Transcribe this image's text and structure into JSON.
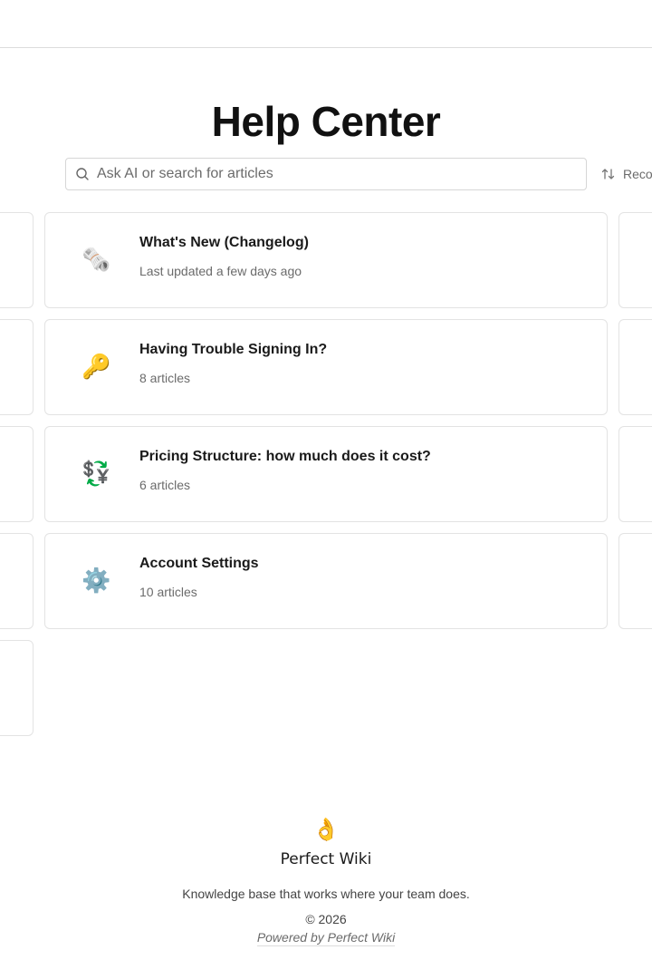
{
  "header": {
    "title": "Help Center"
  },
  "search": {
    "placeholder": "Ask AI or search for articles"
  },
  "sort": {
    "label": "Reco"
  },
  "cards": [
    {
      "emoji": "🗞️",
      "icon": "newspaper-icon",
      "title": "What's New (Changelog)",
      "subtitle": "Last updated a few days ago"
    },
    {
      "emoji": "🔑",
      "icon": "key-icon",
      "title": "Having Trouble Signing In?",
      "subtitle": "8 articles"
    },
    {
      "emoji": "💱",
      "icon": "currency-exchange-icon",
      "title": "Pricing Structure: how much does it cost?",
      "subtitle": "6 articles"
    },
    {
      "emoji": "⚙️",
      "icon": "gear-icon",
      "title": "Account Settings",
      "subtitle": "10 articles"
    }
  ],
  "footer": {
    "emoji": "👌",
    "brand": "Perfect Wiki",
    "tagline": "Knowledge base that works where your team does.",
    "copyright": "© 2026",
    "powered_by": "Powered by Perfect Wiki"
  }
}
